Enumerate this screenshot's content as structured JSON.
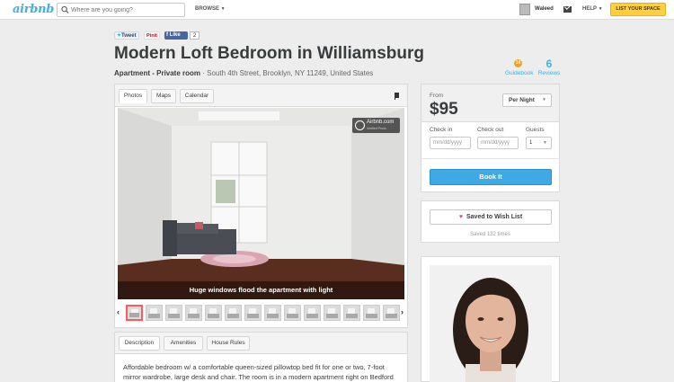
{
  "header": {
    "logo": "airbnb",
    "search_placeholder": "Where are you going?",
    "browse": "BROWSE",
    "user_name": "Waleed",
    "help": "HELP",
    "list_space": "LIST YOUR SPACE"
  },
  "social": {
    "tweet": "Tweet",
    "pin": "Pinit",
    "like": "Like",
    "like_count": "2"
  },
  "listing": {
    "title": "Modern Loft Bedroom in Williamsburg",
    "room_type": "Apartment - Private room",
    "address": "· South 4th Street, Brooklyn, NY 11249, United States"
  },
  "stats": {
    "guidebook_icon": "14",
    "guidebook_label": "Guidebook",
    "reviews_count": "6",
    "reviews_label": "Reviews"
  },
  "media_tabs": [
    "Photos",
    "Maps",
    "Calendar"
  ],
  "photo": {
    "caption": "Huge windows flood the apartment with light",
    "badge_name": "Airbnb.com",
    "badge_sub": "Verified Photo"
  },
  "desc_tabs": [
    "Description",
    "Amenities",
    "House Rules"
  ],
  "description": "Affordable bedroom w/ a comfortable queen-sized pillowtop bed fit for one or two, 7-foot mirror wardrobe, large desk and chair. The room is in a modern apartment right on Bedford Ave in Williamsburg, just minutes from the L train and great restaurants.",
  "booking": {
    "from_label": "From",
    "price": "$95",
    "rate": "Per Night",
    "checkin_label": "Check in",
    "checkout_label": "Check out",
    "guests_label": "Guests",
    "checkin_placeholder": "mm/dd/yyyy",
    "checkout_placeholder": "mm/dd/yyyy",
    "guests_value": "1",
    "book_button": "Book It"
  },
  "wishlist": {
    "button": "Saved to Wish List",
    "saved_text": "Saved 132 times"
  },
  "colors": {
    "brand": "#3fb1e3",
    "book_button": "#3fa9e3",
    "list_space": "#ffcf3c",
    "heart": "#d44c8f"
  }
}
